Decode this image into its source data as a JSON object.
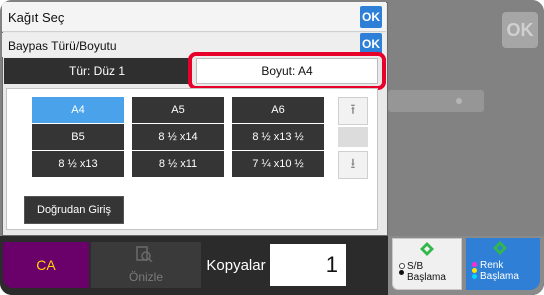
{
  "dialog": {
    "title": "Kağıt Seç",
    "title_ok": "OK",
    "subtitle": "Baypas Türü/Boyutu",
    "subtitle_ok": "OK"
  },
  "tabs": [
    {
      "label": "Tür: Düz 1",
      "selected": false
    },
    {
      "label": "Boyut: A4",
      "selected": true
    }
  ],
  "sizes": [
    {
      "label": "A4",
      "selected": true
    },
    {
      "label": "A5",
      "selected": false
    },
    {
      "label": "A6",
      "selected": false
    },
    {
      "label": "B5",
      "selected": false
    },
    {
      "label": "8 ½ x14",
      "selected": false
    },
    {
      "label": "8 ½ x13 ½",
      "selected": false
    },
    {
      "label": "8 ½ x13",
      "selected": false
    },
    {
      "label": "8 ½ x11",
      "selected": false
    },
    {
      "label": "7 ¼ x10 ½",
      "selected": false
    }
  ],
  "direct_entry": "Doğrudan Giriş",
  "background": {
    "ok": "OK"
  },
  "bottom": {
    "ca": "CA",
    "preview": "Önizle",
    "copies_label": "Kopyalar",
    "copies_value": "1",
    "start_bw_line1": "S/B",
    "start_bw_line2": "Başlama",
    "start_color_line1": "Renk",
    "start_color_line2": "Başlama"
  },
  "colors": {
    "accent": "#2d7fd7",
    "selected_size": "#4aa3ea",
    "highlight": "#e8002b",
    "ca_background": "#6a006a",
    "ca_text": "#ffd400"
  }
}
